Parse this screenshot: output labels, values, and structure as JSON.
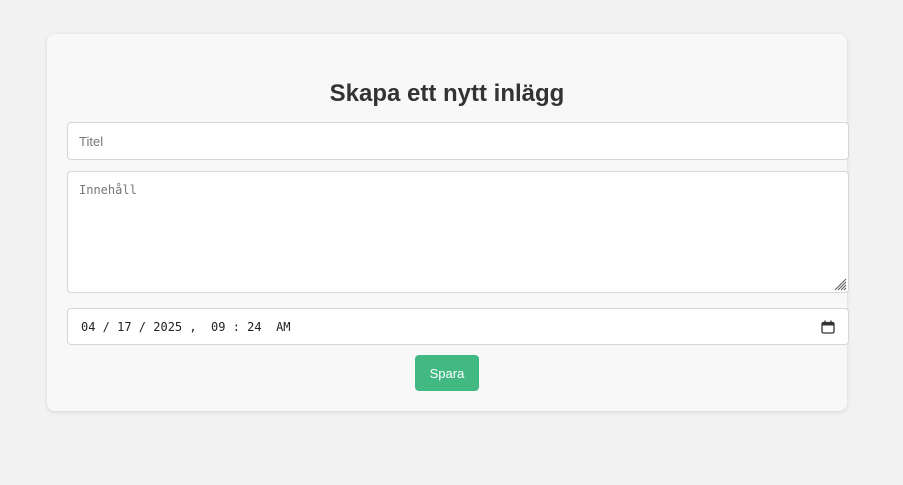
{
  "form": {
    "heading": "Skapa ett nytt inlägg",
    "title_placeholder": "Titel",
    "content_placeholder": "Innehåll",
    "datetime_value": "04 / 17 / 2025 ,  09 : 24  AM",
    "save_label": "Spara"
  },
  "icons": {
    "calendar": "calendar-icon",
    "resize": "resize-grip-icon"
  },
  "colors": {
    "accent": "#42b983",
    "background": "#f2f2f2",
    "card": "#f8f8f8"
  }
}
